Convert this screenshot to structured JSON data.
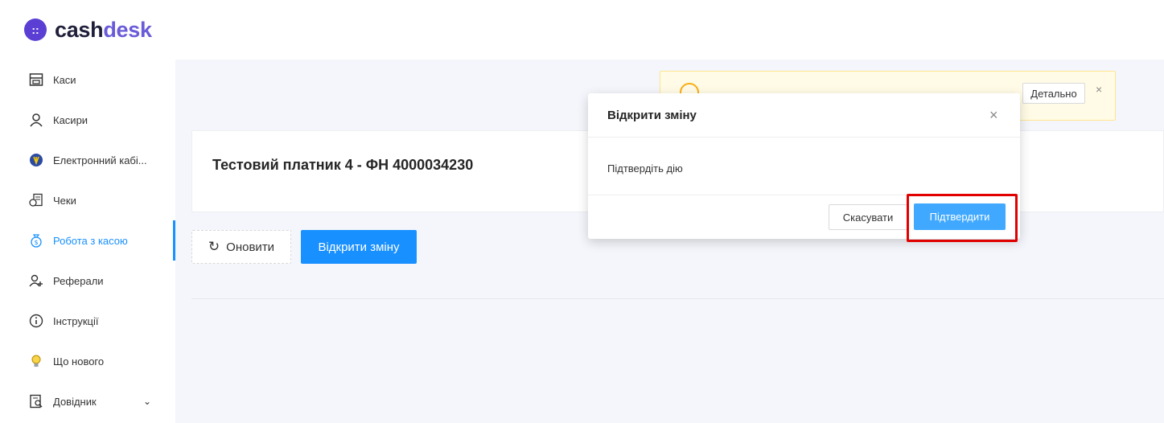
{
  "brand": {
    "cash": "cash",
    "desk": "desk",
    "mark": "::"
  },
  "sidebar": {
    "items": [
      {
        "label": "Каси",
        "icon": "cashbox-icon"
      },
      {
        "label": "Касири",
        "icon": "user-icon"
      },
      {
        "label": "Електронний кабі...",
        "icon": "ukraine-emblem-icon"
      },
      {
        "label": "Чеки",
        "icon": "receipt-icon"
      },
      {
        "label": "Робота з касою",
        "icon": "money-bag-icon"
      },
      {
        "label": "Реферали",
        "icon": "referral-icon"
      },
      {
        "label": "Інструкції",
        "icon": "info-icon"
      },
      {
        "label": "Що нового",
        "icon": "lightbulb-icon"
      },
      {
        "label": "Довідник",
        "icon": "directory-icon"
      }
    ],
    "active_index": 4
  },
  "alert": {
    "detail_label": "Детально",
    "close": "×"
  },
  "card": {
    "title": "Тестовий платник 4 - ФН 4000034230"
  },
  "actions": {
    "refresh_label": "Оновити",
    "open_shift_label": "Відкрити зміну"
  },
  "modal": {
    "title": "Відкрити зміну",
    "close": "×",
    "body": "Підтвердіть дію",
    "cancel_label": "Скасувати",
    "confirm_label": "Підтвердити"
  },
  "colors": {
    "primary": "#1890ff",
    "highlight": "#e00000",
    "brand": "#5b3fd4"
  }
}
